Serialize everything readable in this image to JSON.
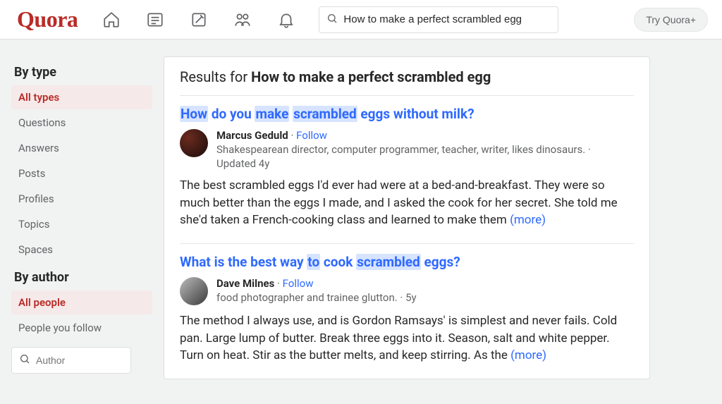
{
  "header": {
    "logo": "Quora",
    "search_value": "How to make a perfect scrambled egg",
    "try_plus": "Try Quora+"
  },
  "sidebar": {
    "by_type_title": "By type",
    "type_filters": [
      "All types",
      "Questions",
      "Answers",
      "Posts",
      "Profiles",
      "Topics",
      "Spaces"
    ],
    "selected_type_index": 0,
    "by_author_title": "By author",
    "author_filters": [
      "All people",
      "People you follow"
    ],
    "selected_author_index": 0,
    "author_placeholder": "Author"
  },
  "results": {
    "prefix": "Results for ",
    "query": "How to make a perfect scrambled egg",
    "items": [
      {
        "title_parts": [
          {
            "t": "How",
            "hl": true
          },
          {
            "t": " do you ",
            "hl": false
          },
          {
            "t": "make",
            "hl": true
          },
          {
            "t": " ",
            "hl": false
          },
          {
            "t": "scrambled",
            "hl": true
          },
          {
            "t": " eggs without milk?",
            "hl": false
          }
        ],
        "author_name": "Marcus Geduld",
        "follow_label": "Follow",
        "author_bio_line1": "Shakespearean director, computer programmer, teacher, writer, likes dinosaurs. ·",
        "author_bio_line2": "Updated 4y",
        "snippet": "The best scrambled eggs I'd ever had were at a bed-and-breakfast. They were so much better than the eggs I made, and I asked the cook for her secret. She told me she'd taken a French-cooking class and learned to make them  ",
        "more_label": "(more)"
      },
      {
        "title_parts": [
          {
            "t": "What is the best way ",
            "hl": false
          },
          {
            "t": "to",
            "hl": true
          },
          {
            "t": " cook ",
            "hl": false
          },
          {
            "t": "scrambled",
            "hl": true
          },
          {
            "t": " eggs?",
            "hl": false
          }
        ],
        "author_name": "Dave Milnes",
        "follow_label": "Follow",
        "author_bio_line1": "food photographer and trainee glutton. · 5y",
        "author_bio_line2": "",
        "snippet": "The method I always use, and is Gordon Ramsays' is simplest and never fails. Cold pan. Large lump of butter. Break three eggs into it. Season, salt and white pepper. Turn on heat. Stir as the butter melts, and keep stirring. As the  ",
        "more_label": "(more)"
      }
    ]
  }
}
